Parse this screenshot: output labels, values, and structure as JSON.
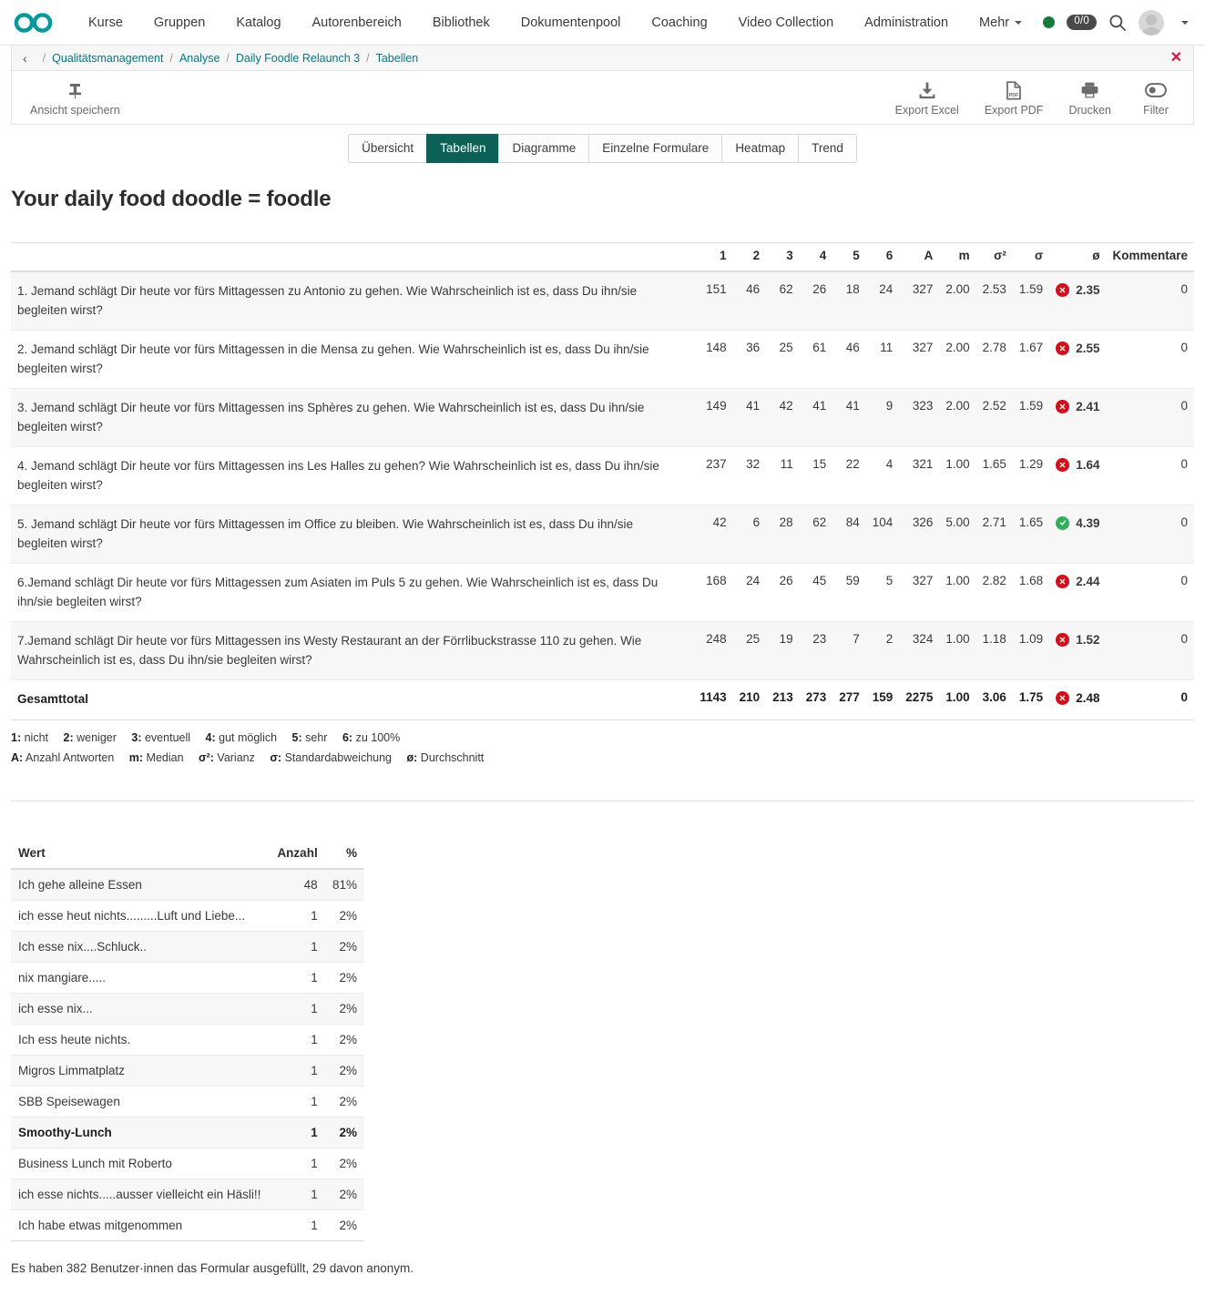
{
  "topnav": {
    "logo_name": "infinity-logo",
    "items": [
      {
        "label": "Kurse"
      },
      {
        "label": "Gruppen"
      },
      {
        "label": "Katalog"
      },
      {
        "label": "Autorenbereich"
      },
      {
        "label": "Bibliothek"
      },
      {
        "label": "Dokumentenpool"
      },
      {
        "label": "Coaching"
      },
      {
        "label": "Video Collection"
      },
      {
        "label": "Administration"
      },
      {
        "label": "Mehr"
      }
    ],
    "status_color": "#137c3a",
    "badge": "0/0",
    "search_icon": "search-icon",
    "avatar_icon": "avatar"
  },
  "breadcrumb": {
    "back": "‹",
    "separator": "/",
    "items": [
      {
        "label": "Qualitätsmanagement"
      },
      {
        "label": "Analyse"
      },
      {
        "label": "Daily Foodle Relaunch 3"
      },
      {
        "label": "Tabellen"
      }
    ],
    "close": "✕"
  },
  "toolbar": {
    "save_view": "Ansicht speichern",
    "export_excel": "Export Excel",
    "export_pdf": "Export PDF",
    "print": "Drucken",
    "filter": "Filter",
    "pdf_glyph": "PDF"
  },
  "tabs": [
    {
      "label": "Übersicht",
      "active": false
    },
    {
      "label": "Tabellen",
      "active": true
    },
    {
      "label": "Diagramme",
      "active": false
    },
    {
      "label": "Einzelne Formulare",
      "active": false
    },
    {
      "label": "Heatmap",
      "active": false
    },
    {
      "label": "Trend",
      "active": false
    }
  ],
  "page_title": "Your daily food doodle = foodle",
  "chart_data": {
    "type": "table",
    "title": "Your daily food doodle = foodle",
    "columns": [
      "",
      "1",
      "2",
      "3",
      "4",
      "5",
      "6",
      "A",
      "m",
      "σ²",
      "σ",
      "ø",
      "Kommentare"
    ],
    "rows": [
      {
        "question": "1. Jemand schlägt Dir heute vor fürs Mittagessen zu Antonio zu gehen. Wie Wahrscheinlich ist es, dass Du ihn/sie begleiten wirst?",
        "c1": "151",
        "c2": "46",
        "c3": "62",
        "c4": "26",
        "c5": "18",
        "c6": "24",
        "a": "327",
        "m": "2.00",
        "var": "2.53",
        "sd": "1.59",
        "avg": "2.35",
        "status": "bad",
        "comments": "0"
      },
      {
        "question": "2. Jemand schlägt Dir heute vor fürs Mittagessen in die Mensa zu gehen. Wie Wahrscheinlich ist es, dass Du ihn/sie begleiten wirst?",
        "c1": "148",
        "c2": "36",
        "c3": "25",
        "c4": "61",
        "c5": "46",
        "c6": "11",
        "a": "327",
        "m": "2.00",
        "var": "2.78",
        "sd": "1.67",
        "avg": "2.55",
        "status": "bad",
        "comments": "0"
      },
      {
        "question": "3. Jemand schlägt Dir heute vor fürs Mittagessen ins Sphères zu gehen. Wie Wahrscheinlich ist es, dass Du ihn/sie begleiten wirst?",
        "c1": "149",
        "c2": "41",
        "c3": "42",
        "c4": "41",
        "c5": "41",
        "c6": "9",
        "a": "323",
        "m": "2.00",
        "var": "2.52",
        "sd": "1.59",
        "avg": "2.41",
        "status": "bad",
        "comments": "0"
      },
      {
        "question": "4. Jemand schlägt Dir heute vor fürs Mittagessen ins Les Halles zu gehen? Wie Wahrscheinlich ist es, dass Du ihn/sie begleiten wirst?",
        "c1": "237",
        "c2": "32",
        "c3": "11",
        "c4": "15",
        "c5": "22",
        "c6": "4",
        "a": "321",
        "m": "1.00",
        "var": "1.65",
        "sd": "1.29",
        "avg": "1.64",
        "status": "bad",
        "comments": "0"
      },
      {
        "question": "5. Jemand schlägt Dir heute vor fürs Mittagessen im Office zu bleiben. Wie Wahrscheinlich ist es, dass Du ihn/sie begleiten wirst?",
        "c1": "42",
        "c2": "6",
        "c3": "28",
        "c4": "62",
        "c5": "84",
        "c6": "104",
        "a": "326",
        "m": "5.00",
        "var": "2.71",
        "sd": "1.65",
        "avg": "4.39",
        "status": "good",
        "comments": "0"
      },
      {
        "question": "6.Jemand schlägt Dir heute vor fürs Mittagessen zum Asiaten im Puls 5 zu gehen. Wie Wahrscheinlich ist es, dass Du ihn/sie begleiten wirst?",
        "c1": "168",
        "c2": "24",
        "c3": "26",
        "c4": "45",
        "c5": "59",
        "c6": "5",
        "a": "327",
        "m": "1.00",
        "var": "2.82",
        "sd": "1.68",
        "avg": "2.44",
        "status": "bad",
        "comments": "0"
      },
      {
        "question": "7.Jemand schlägt Dir heute vor fürs Mittagessen ins Westy Restaurant an der Förrlibuckstrasse 110 zu gehen. Wie Wahrscheinlich ist es, dass Du ihn/sie begleiten wirst?",
        "c1": "248",
        "c2": "25",
        "c3": "19",
        "c4": "23",
        "c5": "7",
        "c6": "2",
        "a": "324",
        "m": "1.00",
        "var": "1.18",
        "sd": "1.09",
        "avg": "1.52",
        "status": "bad",
        "comments": "0"
      }
    ],
    "total": {
      "question": "Gesamttotal",
      "c1": "1143",
      "c2": "210",
      "c3": "213",
      "c4": "273",
      "c5": "277",
      "c6": "159",
      "a": "2275",
      "m": "1.00",
      "var": "3.06",
      "sd": "1.75",
      "avg": "2.48",
      "status": "bad",
      "comments": "0"
    }
  },
  "legend": {
    "scale": [
      {
        "key": "1:",
        "val": "nicht"
      },
      {
        "key": "2:",
        "val": "weniger"
      },
      {
        "key": "3:",
        "val": "eventuell"
      },
      {
        "key": "4:",
        "val": "gut möglich"
      },
      {
        "key": "5:",
        "val": "sehr"
      },
      {
        "key": "6:",
        "val": "zu 100%"
      }
    ],
    "stats": [
      {
        "key": "A:",
        "val": "Anzahl Antworten"
      },
      {
        "key": "m:",
        "val": "Median"
      },
      {
        "key": "σ²:",
        "val": "Varianz"
      },
      {
        "key": "σ:",
        "val": "Standardabweichung"
      },
      {
        "key": "ø:",
        "val": "Durchschnitt"
      }
    ]
  },
  "values_table": {
    "headers": {
      "wert": "Wert",
      "anzahl": "Anzahl",
      "percent": "%"
    },
    "rows": [
      {
        "wert": "Ich gehe alleine Essen",
        "anzahl": "48",
        "percent": "81%",
        "bold": false
      },
      {
        "wert": "ich esse heut nichts.........Luft und Liebe...",
        "anzahl": "1",
        "percent": "2%",
        "bold": false
      },
      {
        "wert": "Ich esse nix....Schluck..",
        "anzahl": "1",
        "percent": "2%",
        "bold": false
      },
      {
        "wert": "nix mangiare.....",
        "anzahl": "1",
        "percent": "2%",
        "bold": false
      },
      {
        "wert": "ich esse nix...",
        "anzahl": "1",
        "percent": "2%",
        "bold": false
      },
      {
        "wert": "Ich ess heute nichts.",
        "anzahl": "1",
        "percent": "2%",
        "bold": false
      },
      {
        "wert": "Migros Limmatplatz",
        "anzahl": "1",
        "percent": "2%",
        "bold": false
      },
      {
        "wert": "SBB Speisewagen",
        "anzahl": "1",
        "percent": "2%",
        "bold": false
      },
      {
        "wert": "Smoothy-Lunch",
        "anzahl": "1",
        "percent": "2%",
        "bold": true
      },
      {
        "wert": "Business Lunch mit Roberto",
        "anzahl": "1",
        "percent": "2%",
        "bold": false
      },
      {
        "wert": "ich esse nichts.....ausser vielleicht ein Häsli!!",
        "anzahl": "1",
        "percent": "2%",
        "bold": false
      },
      {
        "wert": "Ich habe etwas mitgenommen",
        "anzahl": "1",
        "percent": "2%",
        "bold": false
      }
    ]
  },
  "footnote": "Es haben 382 Benutzer·innen das Formular ausgefüllt, 29 davon anonym.",
  "colors": {
    "brand_teal": "#009b9b",
    "tab_active": "#0b6156",
    "link": "#007c86",
    "bad": "#e30613",
    "good": "#2eb257",
    "close_red": "#e8113c",
    "status_green": "#137c3a"
  }
}
